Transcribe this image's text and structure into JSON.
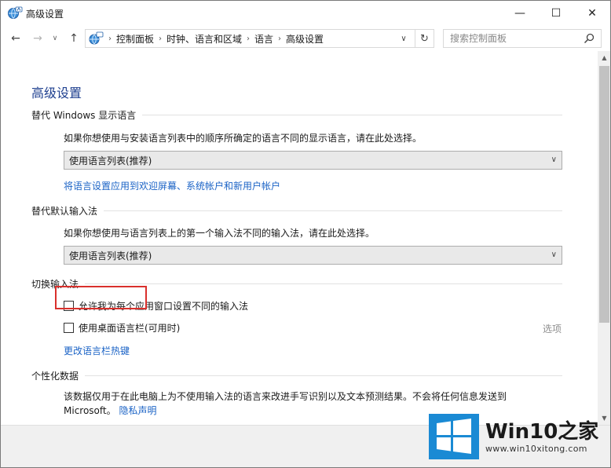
{
  "window": {
    "title": "高级设置",
    "minimize_glyph": "—",
    "maximize_glyph": "☐",
    "close_glyph": "✕"
  },
  "nav": {
    "back_glyph": "←",
    "forward_glyph": "→",
    "recent_glyph": "∨",
    "up_glyph": "↑",
    "breadcrumbs": [
      "控制面板",
      "时钟、语言和区域",
      "语言",
      "高级设置"
    ],
    "dropdown_glyph": "∨",
    "refresh_glyph": "↻",
    "search_placeholder": "搜索控制面板"
  },
  "page": {
    "title": "高级设置",
    "sections": {
      "display_language": {
        "header": "替代 Windows 显示语言",
        "description": "如果你想使用与安装语言列表中的顺序所确定的语言不同的显示语言，请在此处选择。",
        "select_value": "使用语言列表(推荐)",
        "link": "将语言设置应用到欢迎屏幕、系统帐户和新用户帐户"
      },
      "input_method": {
        "header": "替代默认输入法",
        "description": "如果你想使用与语言列表上的第一个输入法不同的输入法，请在此处选择。",
        "select_value": "使用语言列表(推荐)"
      },
      "switch_input": {
        "header": "切换输入法",
        "checkbox1": "允许我为每个应用窗口设置不同的输入法",
        "checkbox2": "使用桌面语言栏(可用时)",
        "options_link": "选项",
        "hotkey_link": "更改语言栏热键"
      },
      "personalization": {
        "header": "个性化数据",
        "description_line1": "该数据仅用于在此电脑上为不使用输入法的语言来改进手写识别以及文本预测结果。不会将任何信息发送到",
        "description_line2_prefix": "Microsoft。",
        "privacy_link": "隐私声明"
      }
    }
  },
  "watermark": {
    "brand_prefix": "Win10",
    "brand_suffix": "之家",
    "url": "www.win10xitong.com"
  },
  "colors": {
    "accent_blue": "#1b63c6",
    "title_blue": "#1e3f8f",
    "highlight_red": "#d9302c",
    "logo_blue": "#1a8ad4"
  }
}
